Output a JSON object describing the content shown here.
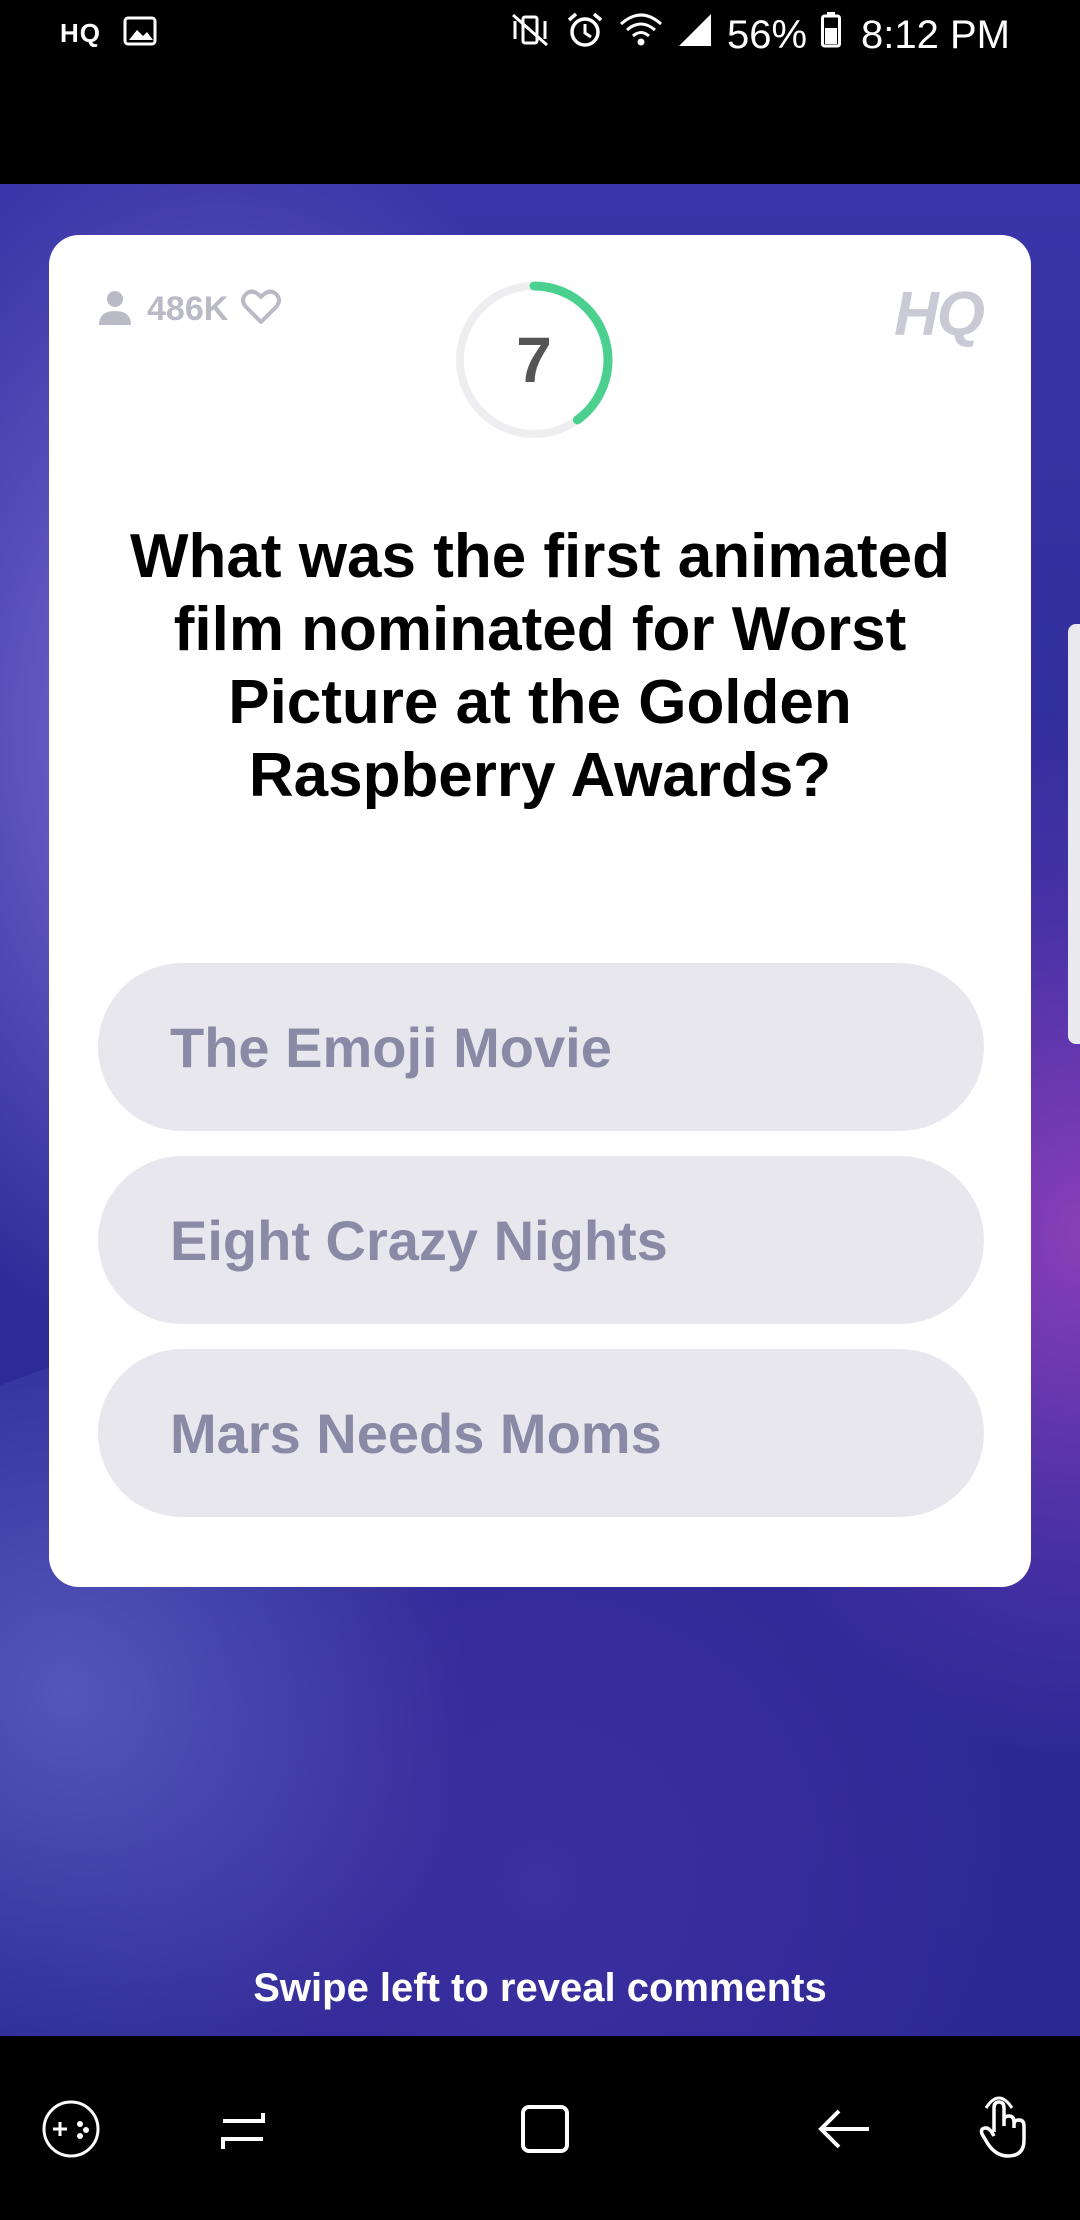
{
  "status_bar": {
    "left_app_label": "HQ",
    "battery_percent": "56%",
    "time": "8:12 PM"
  },
  "card": {
    "viewer_count": "486K",
    "brand": "HQ",
    "timer_seconds": "7",
    "timer_progress": 0.4,
    "question": "What was the first animated film nominated for Worst Picture at the Golden Raspberry Awards?",
    "answers": [
      {
        "label": "The Emoji Movie"
      },
      {
        "label": "Eight Crazy Nights"
      },
      {
        "label": "Mars Needs Moms"
      }
    ]
  },
  "swipe_hint": "Swipe left to reveal comments",
  "colors": {
    "timer_accent": "#4cd08f",
    "answer_bg": "#e8e7ee",
    "answer_text": "#8b8aa6",
    "stage_bg": "#2f2c9a"
  },
  "nav_bar": {
    "icons": [
      "game-tools-icon",
      "recent-apps-icon",
      "home-icon",
      "back-icon",
      "touch-gesture-icon"
    ]
  }
}
